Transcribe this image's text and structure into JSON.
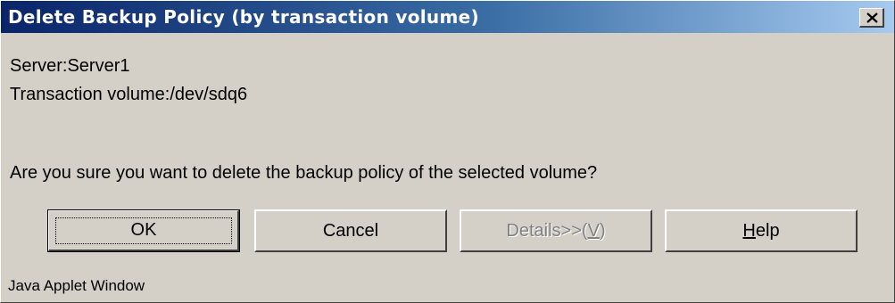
{
  "window": {
    "title": "Delete Backup Policy (by transaction volume)",
    "close_icon": "close-icon"
  },
  "info": {
    "server": "Server:Server1",
    "volume": "Transaction volume:/dev/sdq6"
  },
  "message": "Are you sure you want to delete the backup policy of the selected volume?",
  "buttons": {
    "ok": "OK",
    "cancel": "Cancel",
    "details_prefix": "Details>>(",
    "details_mnemonic": "V",
    "details_suffix": ")",
    "help_mnemonic": "H",
    "help_rest": "elp"
  },
  "footer": "Java Applet Window",
  "colors": {
    "title_start": "#0a246a",
    "title_end": "#a6caf0",
    "face": "#d4d0c8"
  }
}
